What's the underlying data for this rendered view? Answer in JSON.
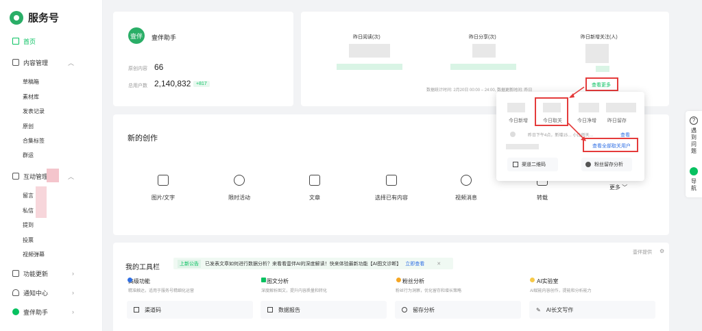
{
  "brand": {
    "name": "服务号"
  },
  "nav": {
    "home": "首页",
    "content": "内容管理",
    "content_subs": [
      "草稿箱",
      "素材库",
      "发表记录",
      "原创",
      "合集标签",
      "群运"
    ],
    "interaction": "互动管理",
    "interaction_subs": [
      "留言",
      "私信",
      "提到",
      "投票",
      "视频弹幕"
    ],
    "features": "功能更新",
    "notifications": "通知中心",
    "assistant": "壹伴助手"
  },
  "account": {
    "avatar_text": "壹伴",
    "name": "壹伴助手",
    "original_label": "原创内容",
    "original_value": "66",
    "users_label": "总用户数",
    "users_value": "2,140,832",
    "users_delta": "+817"
  },
  "stats": {
    "col1": "昨日阅读(次)",
    "col2": "昨日分享(次)",
    "col3": "昨日新增关注(人)",
    "footnote": "数据统计时间: 2月20日 00:00 – 24:00, 数据更新时间: 昨日",
    "more": "查看更多"
  },
  "popup": {
    "labels": [
      "今日新增",
      "今日取关",
      "今日净增",
      "昨日留存"
    ],
    "message": "昨日下午4点，新增15… 小比例天…",
    "view": "查看",
    "view_all_unfollow": "查看全部取关用户",
    "btn_qr": "渠道二维码",
    "btn_fans": "粉丝留存分析"
  },
  "create": {
    "title": "新的创作",
    "items": [
      "图片/文字",
      "限时活动",
      "文章",
      "选择已有内容",
      "视频消息",
      "转载"
    ],
    "more": "更多"
  },
  "toolbar": {
    "title": "我的工具栏",
    "notice_tag": "上新公告",
    "notice_text": "已发表文章如何进行数据分析？来看看壹伴AI的深度解读！快来体验最新功能【AI图文诊断】",
    "notice_link": "立即查看",
    "side_link": "壹伴提供",
    "sections": [
      {
        "title": "高级功能",
        "desc": "精准触达，适用于服务号精细化运营",
        "button": "渠道码"
      },
      {
        "title": "图文分析",
        "desc": "深度解析图文，提升内容质量和转化",
        "button": "数据报告"
      },
      {
        "title": "粉丝分析",
        "desc": "粉丝行为洞察，优化留存和增长策略",
        "button": "留存分析"
      },
      {
        "title": "AI实验室",
        "desc": "AI赋能内容创作，提能和分析能力",
        "button": "AI长文写作"
      }
    ]
  },
  "rightbar": {
    "help": "遇到问题",
    "nav": "导航"
  }
}
